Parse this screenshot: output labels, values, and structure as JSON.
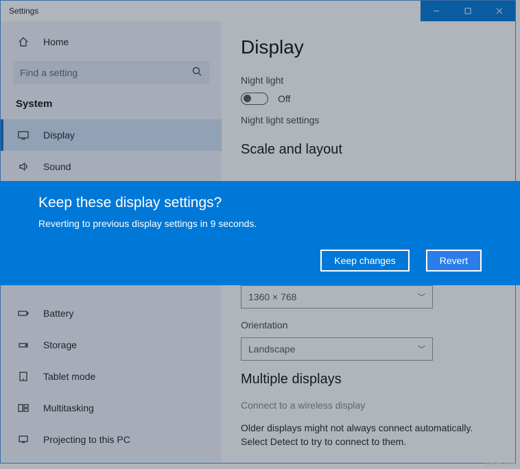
{
  "window": {
    "title": "Settings"
  },
  "sidebar": {
    "home": "Home",
    "search_placeholder": "Find a setting",
    "section": "System",
    "items": [
      {
        "label": "Display"
      },
      {
        "label": "Sound"
      },
      {
        "label": "Battery"
      },
      {
        "label": "Storage"
      },
      {
        "label": "Tablet mode"
      },
      {
        "label": "Multitasking"
      },
      {
        "label": "Projecting to this PC"
      }
    ]
  },
  "main": {
    "title": "Display",
    "night_light_label": "Night light",
    "night_light_state": "Off",
    "night_light_settings": "Night light settings",
    "scale_section": "Scale and layout",
    "resolution_value": "1360 × 768",
    "orientation_label": "Orientation",
    "orientation_value": "Landscape",
    "multiple_section": "Multiple displays",
    "wireless_link": "Connect to a wireless display",
    "detect_help": "Older displays might not always connect automatically. Select Detect to try to connect to them."
  },
  "dialog": {
    "title": "Keep these display settings?",
    "text": "Reverting to previous display settings in  9 seconds.",
    "keep": "Keep changes",
    "revert": "Revert"
  },
  "watermark": "wsxdn.com"
}
